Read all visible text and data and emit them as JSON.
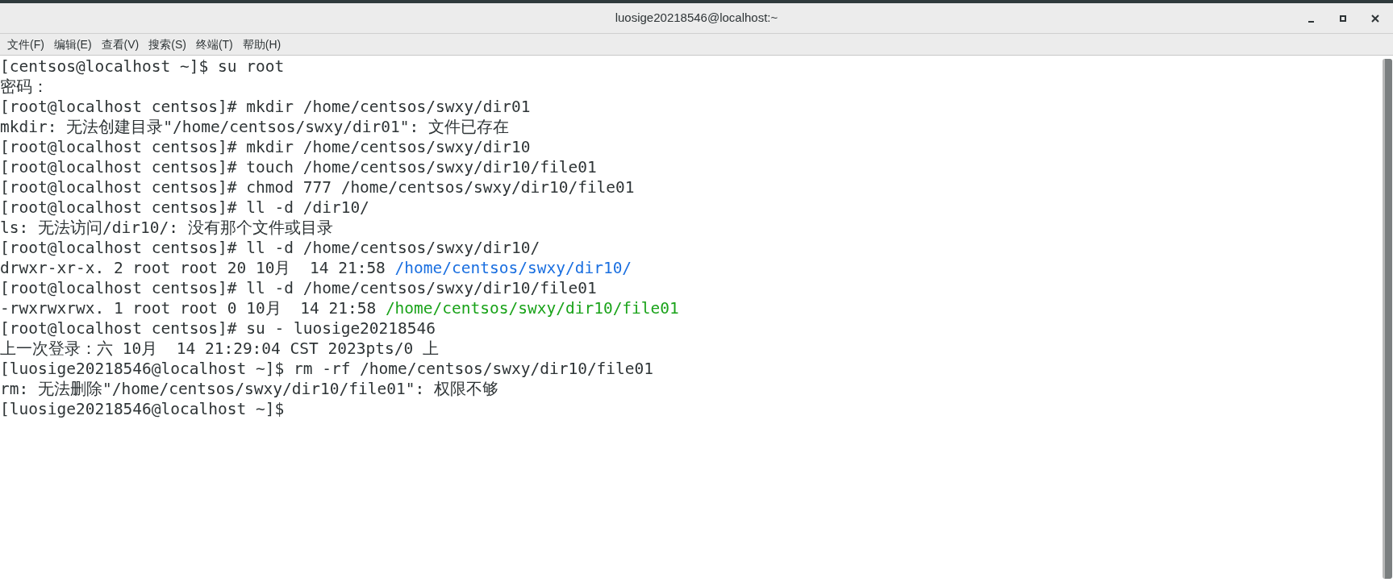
{
  "window": {
    "title": "luosige20218546@localhost:~"
  },
  "menu": [
    "文件(F)",
    "编辑(E)",
    "查看(V)",
    "搜索(S)",
    "终端(T)",
    "帮助(H)"
  ],
  "terminal": {
    "lines": [
      [
        {
          "kind": "plain",
          "text": "[centsos@localhost ~]$ su root"
        }
      ],
      [
        {
          "kind": "plain",
          "text": "密码："
        }
      ],
      [
        {
          "kind": "plain",
          "text": "[root@localhost centsos]# mkdir /home/centsos/swxy/dir01"
        }
      ],
      [
        {
          "kind": "plain",
          "text": "mkdir: 无法创建目录\"/home/centsos/swxy/dir01\": 文件已存在"
        }
      ],
      [
        {
          "kind": "plain",
          "text": "[root@localhost centsos]# mkdir /home/centsos/swxy/dir10"
        }
      ],
      [
        {
          "kind": "plain",
          "text": "[root@localhost centsos]# touch /home/centsos/swxy/dir10/file01"
        }
      ],
      [
        {
          "kind": "plain",
          "text": "[root@localhost centsos]# chmod 777 /home/centsos/swxy/dir10/file01"
        }
      ],
      [
        {
          "kind": "plain",
          "text": "[root@localhost centsos]# ll -d /dir10/"
        }
      ],
      [
        {
          "kind": "plain",
          "text": "ls: 无法访问/dir10/: 没有那个文件或目录"
        }
      ],
      [
        {
          "kind": "plain",
          "text": "[root@localhost centsos]# ll -d /home/centsos/swxy/dir10/"
        }
      ],
      [
        {
          "kind": "plain",
          "text": "drwxr-xr-x. 2 root root 20 10月  14 21:58 "
        },
        {
          "kind": "directory",
          "text": "/home/centsos/swxy/dir10/"
        }
      ],
      [
        {
          "kind": "plain",
          "text": "[root@localhost centsos]# ll -d /home/centsos/swxy/dir10/file01"
        }
      ],
      [
        {
          "kind": "plain",
          "text": "-rwxrwxrwx. 1 root root 0 10月  14 21:58 "
        },
        {
          "kind": "executable",
          "text": "/home/centsos/swxy/dir10/file01"
        }
      ],
      [
        {
          "kind": "plain",
          "text": "[root@localhost centsos]# su - luosige20218546"
        }
      ],
      [
        {
          "kind": "plain",
          "text": "上一次登录：六 10月  14 21:29:04 CST 2023pts/0 上"
        }
      ],
      [
        {
          "kind": "plain",
          "text": "[luosige20218546@localhost ~]$ rm -rf /home/centsos/swxy/dir10/file01"
        }
      ],
      [
        {
          "kind": "plain",
          "text": "rm: 无法删除\"/home/centsos/swxy/dir10/file01\": 权限不够"
        }
      ],
      [
        {
          "kind": "plain",
          "text": "[luosige20218546@localhost ~]$"
        }
      ]
    ]
  }
}
